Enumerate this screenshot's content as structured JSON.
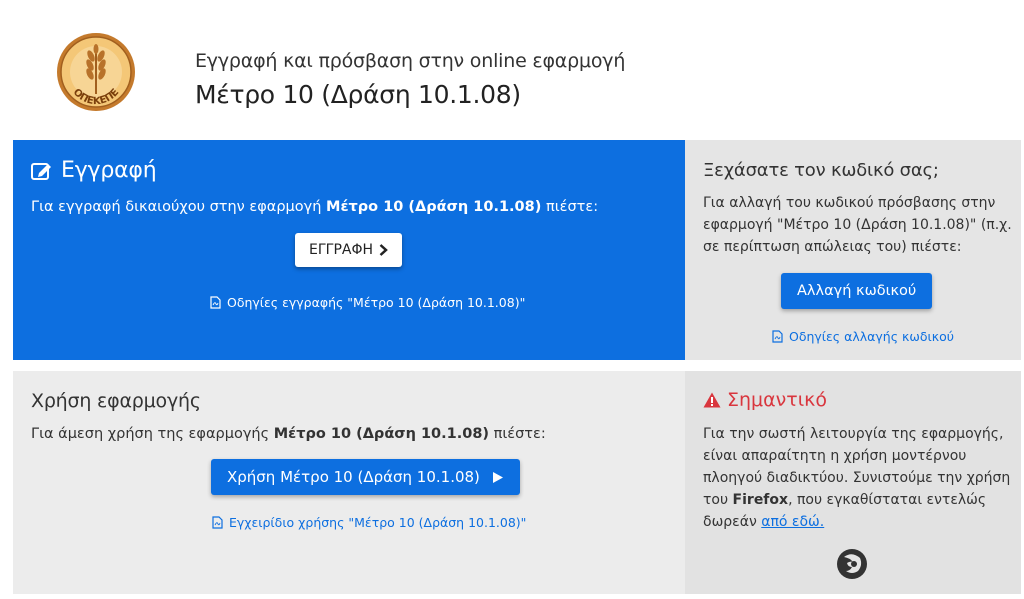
{
  "header": {
    "logo_text": "ΟΠΕΚΕΠΕ",
    "subtitle": "Εγγραφή και πρόσβαση στην online εφαρμογή",
    "title": "Μέτρο 10 (Δράση 10.1.08)"
  },
  "register": {
    "title": "Εγγραφή",
    "text_prefix": "Για εγγραφή δικαιούχου στην εφαρμογή ",
    "text_bold": "Μέτρο 10 (Δράση 10.1.08)",
    "text_suffix": " πιέστε:",
    "button_label": "ΕΓΓΡΑΦΗ",
    "doc_link": "Οδηγίες εγγραφής \"Μέτρο 10 (Δράση 10.1.08)\""
  },
  "forgot": {
    "title": "Ξεχάσατε τον κωδικό σας;",
    "text_line1": "Για αλλαγή του κωδικού πρόσβασης στην",
    "text_line2": "εφαρμογή \"Μέτρο 10 (Δράση 10.1.08)\" (π.χ.",
    "text_line3": "σε περίπτωση απώλειας του) πιέστε:",
    "button_label": "Αλλαγή κωδικού",
    "doc_link": "Οδηγίες αλλαγής κωδικού"
  },
  "use": {
    "title": "Χρήση εφαρμογής",
    "text_prefix": "Για άμεση χρήση της εφαρμογής ",
    "text_bold": "Μέτρο 10 (Δράση 10.1.08)",
    "text_suffix": " πιέστε:",
    "button_label": "Χρήση Μέτρο 10 (Δράση 10.1.08)",
    "doc_link": "Εγχειρίδιο χρήσης \"Μέτρο 10 (Δράση 10.1.08)\""
  },
  "important": {
    "title": "Σημαντικό",
    "line1": "Για την σωστή λειτουργία της εφαρμογής,",
    "line2": "είναι απαραίτητη η χρήση μοντέρνου",
    "line3": "πλοηγού διαδικτύου. Συνιστούμε την χρήση",
    "line4_prefix": "του ",
    "line4_bold": "Firefox",
    "line4_suffix": ", που εγκαθίσταται εντελώς",
    "line5_prefix": "δωρεάν ",
    "line5_link": "από εδώ."
  },
  "colors": {
    "accent_blue": "#0d6fe0",
    "warning_red": "#d9363e"
  }
}
